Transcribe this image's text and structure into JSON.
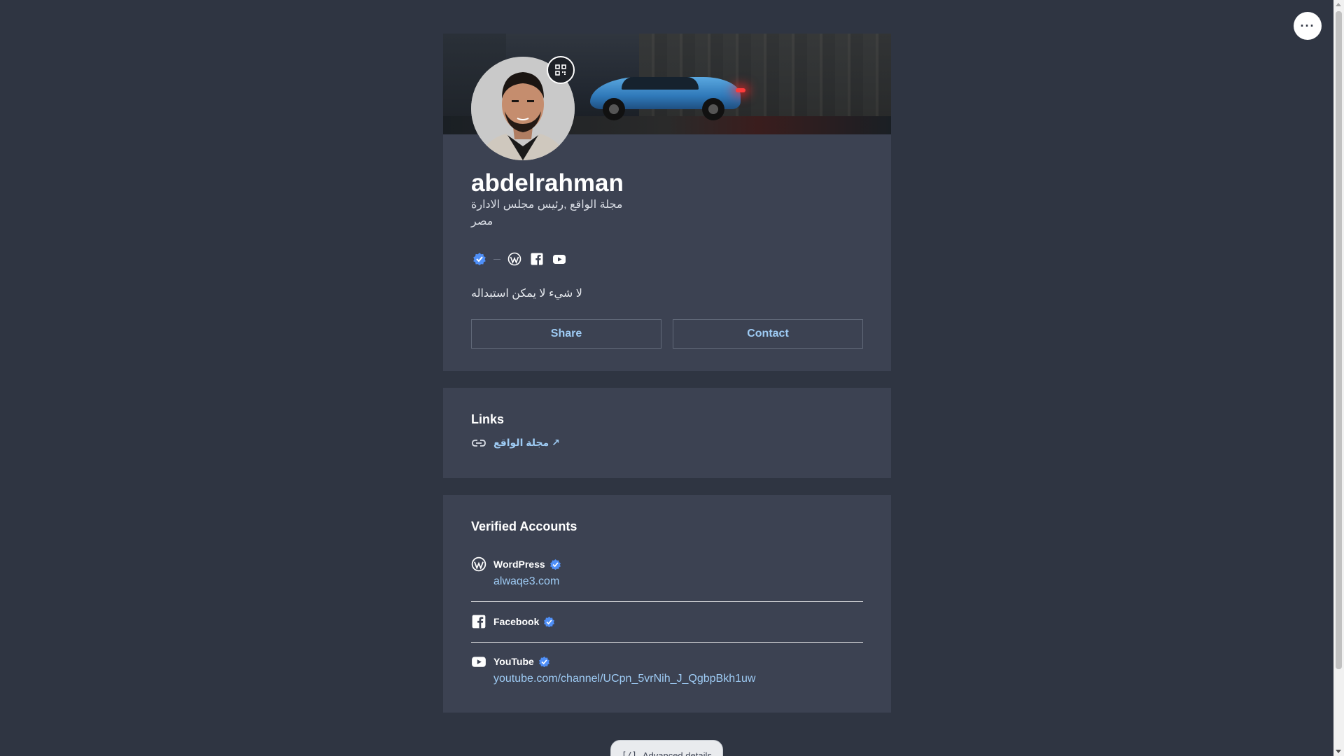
{
  "profile": {
    "name": "abdelrahman",
    "headline": "مجلة الواقع ,رئيس مجلس الادارة",
    "location": "مصر",
    "bio": "لا شيء لا يمكن استبداله",
    "social_icons": [
      "verified-badge-icon",
      "wordpress-icon",
      "facebook-icon",
      "youtube-icon"
    ]
  },
  "actions": {
    "share_label": "Share",
    "contact_label": "Contact"
  },
  "links": {
    "title": "Links",
    "items": [
      {
        "label": "مجلة الواقع ↗",
        "icon": "link-icon"
      }
    ]
  },
  "verified": {
    "title": "Verified Accounts",
    "accounts": [
      {
        "name": "WordPress",
        "url": "alwaqe3.com",
        "icon": "wordpress-icon"
      },
      {
        "name": "Facebook",
        "url": "",
        "icon": "facebook-icon"
      },
      {
        "name": "YouTube",
        "url": "youtube.com/channel/UCpn_5vrNih_J_QgbpBkh1uw",
        "icon": "youtube-icon"
      }
    ]
  },
  "footer": {
    "advanced_label": "Advanced details",
    "advanced_icon": "[/]"
  },
  "menu": {
    "more_label": "···"
  },
  "colors": {
    "page_bg": "#2f3542",
    "card_bg": "#3c4252",
    "link": "#9ecbf4",
    "verified_badge": "#4f8ff7"
  }
}
